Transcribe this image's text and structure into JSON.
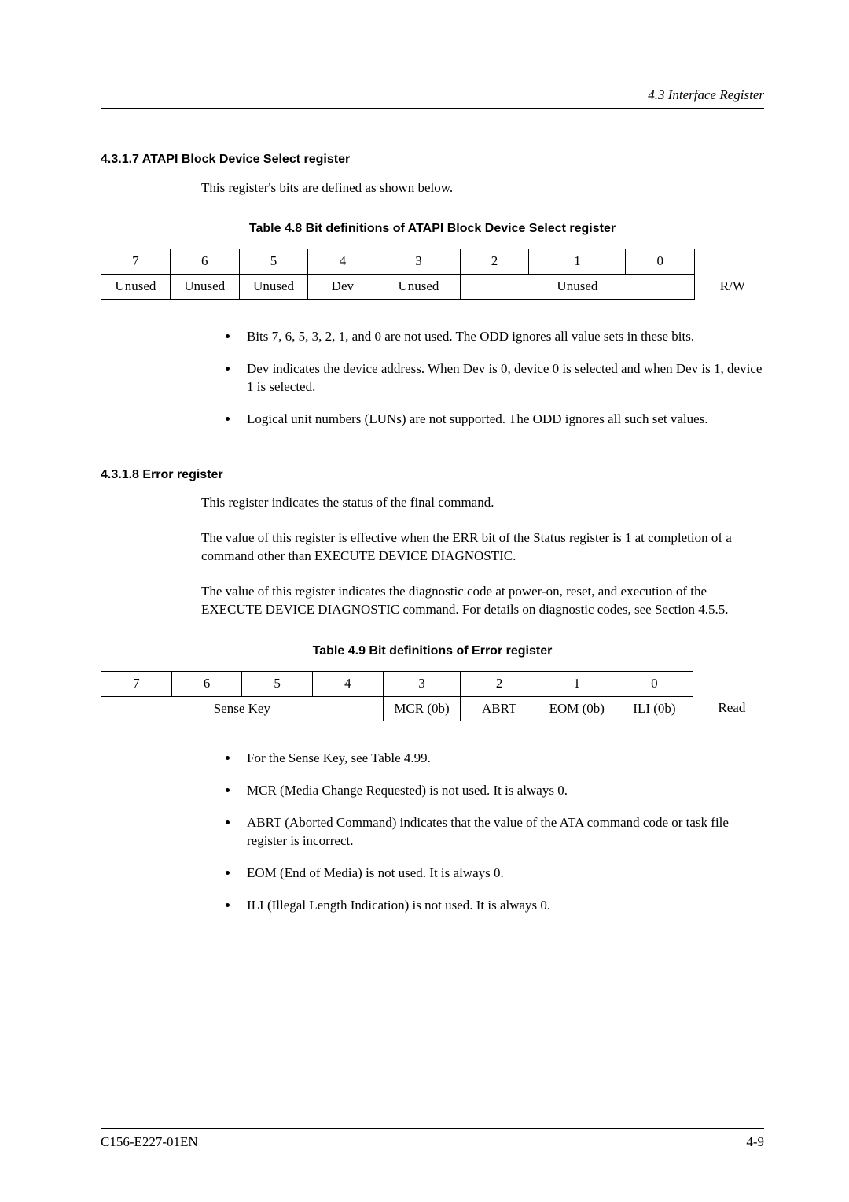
{
  "header": {
    "section_ref": "4.3  Interface Register"
  },
  "section1": {
    "heading": "4.3.1.7  ATAPI Block Device Select register",
    "intro": "This register's bits are defined as shown below.",
    "table_caption": "Table 4.8    Bit definitions of ATAPI Block Device Select register",
    "bits": [
      "7",
      "6",
      "5",
      "4",
      "3",
      "2",
      "1",
      "0"
    ],
    "row": {
      "c7": "Unused",
      "c6": "Unused",
      "c5": "Unused",
      "c4": "Dev",
      "c3": "Unused",
      "c210": "Unused"
    },
    "access": "R/W",
    "bullets": [
      "Bits 7, 6, 5, 3, 2, 1, and 0 are not used.  The ODD ignores all value sets in these bits.",
      "Dev indicates the device address.  When Dev is 0, device 0 is selected and when Dev is 1, device 1 is selected.",
      "Logical unit numbers (LUNs) are not supported.  The ODD ignores all such set values."
    ]
  },
  "section2": {
    "heading": "4.3.1.8  Error register",
    "p1": "This register indicates the status of the final command.",
    "p2": "The value of this register is effective when the ERR bit of the Status register is 1 at completion of a command other than EXECUTE DEVICE DIAGNOSTIC.",
    "p3": "The value of this register indicates the diagnostic code at power-on, reset, and execution of the EXECUTE DEVICE DIAGNOSTIC command.  For details on diagnostic codes, see Section 4.5.5.",
    "table_caption": "Table 4.9    Bit definitions of Error register",
    "bits": [
      "7",
      "6",
      "5",
      "4",
      "3",
      "2",
      "1",
      "0"
    ],
    "row": {
      "sense_key": "Sense Key",
      "mcr": "MCR (0b)",
      "abrt": "ABRT",
      "eom": "EOM (0b)",
      "ili": "ILI (0b)"
    },
    "access": "Read",
    "bullets": [
      "For the Sense Key, see Table 4.99.",
      "MCR (Media Change Requested) is not used.  It is always 0.",
      "ABRT (Aborted Command) indicates that the value of the ATA command code or task file register is incorrect.",
      "EOM (End of Media) is not used.  It is always 0.",
      "ILI (Illegal Length Indication) is not used.  It is always 0."
    ]
  },
  "footer": {
    "doc_id": "C156-E227-01EN",
    "page_num": "4-9"
  }
}
